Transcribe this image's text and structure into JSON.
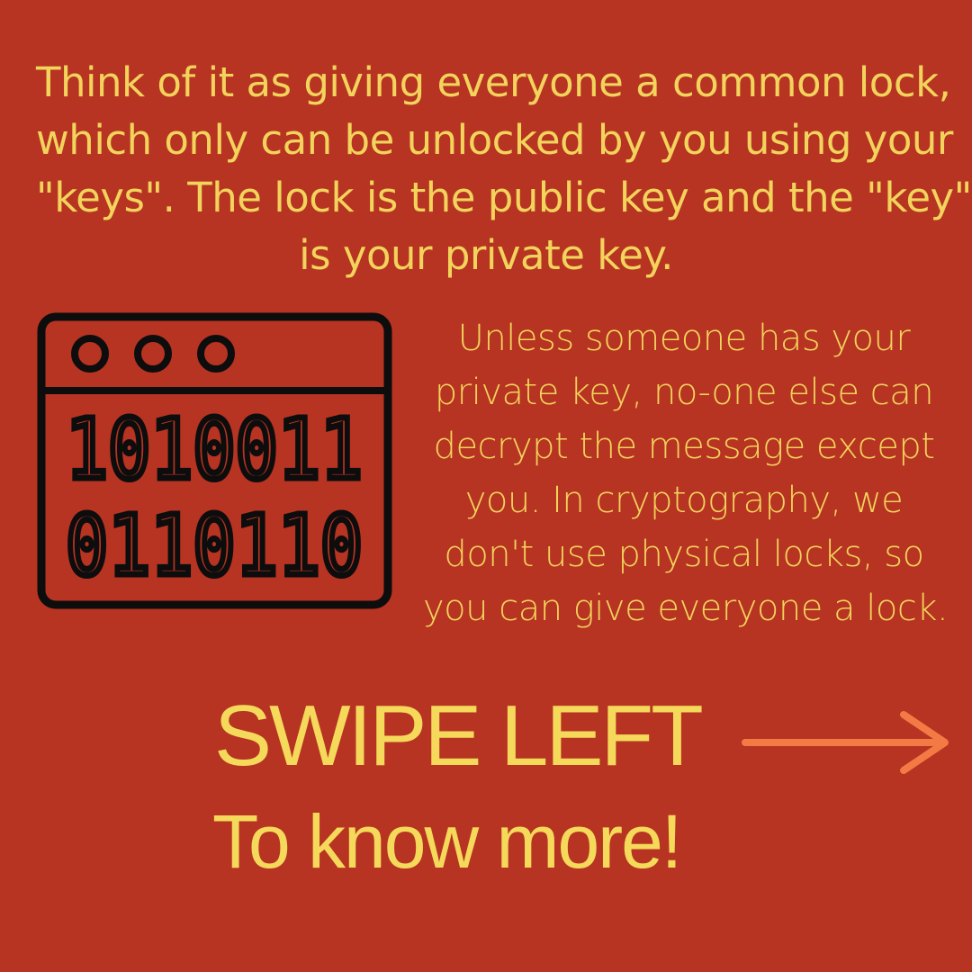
{
  "intro": {
    "lines": [
      "Think of it as giving everyone a common lock,",
      "which only can be unlocked by you using your",
      "\"keys\". The lock is the public key and the \"key\"",
      "is your private key."
    ]
  },
  "illustration": {
    "icon": "binary-code-window-icon",
    "binary_rows": [
      "1010011",
      "0110110"
    ]
  },
  "detail": {
    "lines": [
      "Unless someone has your",
      "private key, no-one else can",
      "decrypt the message except",
      "you. In cryptography, we",
      "don't use physical locks, so",
      "you can give everyone a lock."
    ]
  },
  "cta": {
    "swipe_label": "SWIPE LEFT",
    "arrow_icon": "right-arrow-icon",
    "subtitle": "To know more!"
  },
  "colors": {
    "background": "#b73322",
    "text": "#f2d35b",
    "arrow": "#f47a45",
    "icon_stroke": "#0d0d0d"
  }
}
